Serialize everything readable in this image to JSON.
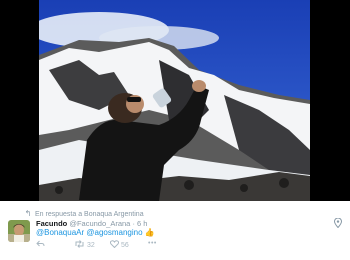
{
  "reply": {
    "icon": "reply-arrow-icon",
    "text": "En respuesta a Bonaqua Argentina"
  },
  "author": {
    "name": "Facundo",
    "handle": "@Facundo_Arana",
    "separator": "·",
    "time": "6 h"
  },
  "tweet": {
    "mention1": "@BonaquaAr",
    "mention2": "@agosmangino",
    "emoji": "thumbs-up-icon"
  },
  "actions": {
    "reply_count": "",
    "retweets": "32",
    "likes": "56",
    "more": "•••"
  },
  "colors": {
    "link": "#1b95e0",
    "muted": "#8899a6",
    "name": "#14171a"
  }
}
